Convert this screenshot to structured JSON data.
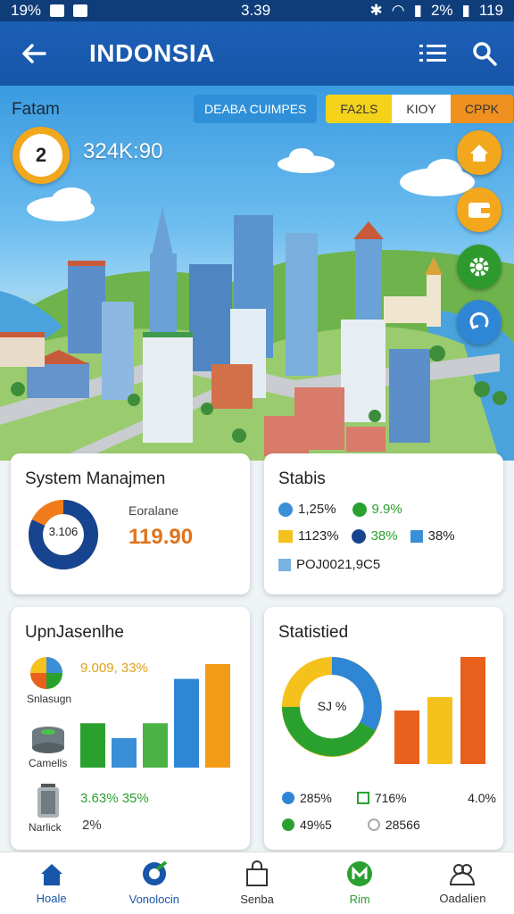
{
  "status": {
    "battery_left": "19%",
    "time": "3.39",
    "battery_right": "2%",
    "extra": "119"
  },
  "app_bar": {
    "title": "INDONSIA"
  },
  "hero": {
    "player_name": "Fatam",
    "tab_chip": "DEABA CUIMPES",
    "segments": [
      "FA2LS",
      "KIOY",
      "CPPK"
    ],
    "level": "2",
    "score": "324K:90"
  },
  "system": {
    "title": "System Manajmen",
    "donut_label": "3.106",
    "metric_label": "Eoralane",
    "metric_value": "119.90",
    "donut_fraction": 0.82
  },
  "stats": {
    "title": "Stabis",
    "r1a": "1,25%",
    "r1b": "9.9%",
    "r2a": "1123%",
    "r2b": "38%",
    "r2c": "38%",
    "r3a": "POJ0021,9C5"
  },
  "jasen": {
    "title": "UpnJasenlhe",
    "row1_value": "9.009, 33%",
    "row1_label": "Snlasugn",
    "row2_label": "Camells",
    "row3_value": "3.63% 35%",
    "row3_label": "Narlick",
    "row3_b": "2%"
  },
  "statistied": {
    "title": "Statistied",
    "donut_label": "SJ %",
    "r1a": "285%",
    "r1b": "716%",
    "r1c": "4.0%",
    "r2a": "49%5",
    "r2b": "28566"
  },
  "chart_data": [
    {
      "type": "bar",
      "values": [
        6,
        4,
        6,
        12,
        14
      ],
      "colors": [
        "#2aa12f",
        "#3b8fd6",
        "#4ab344",
        "#2f86d4",
        "#f29b17"
      ]
    },
    {
      "type": "bar",
      "values": [
        8,
        10,
        16
      ],
      "colors": [
        "#e8601c",
        "#f5c11d",
        "#e8601c"
      ]
    }
  ],
  "nav": [
    "Hoale",
    "Vonolocin",
    "Senba",
    "Rim",
    "Oadalien"
  ]
}
